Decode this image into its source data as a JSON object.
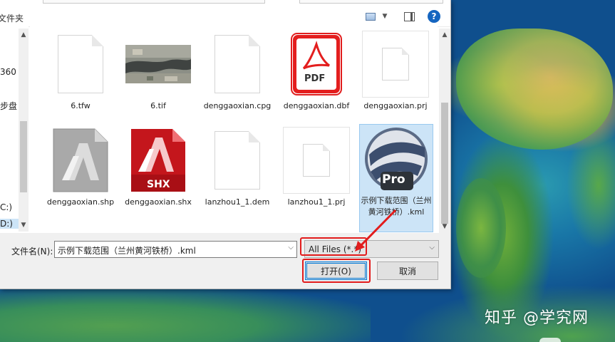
{
  "window": {
    "nav_label": "文件夹"
  },
  "left_nav": {
    "items": [
      {
        "label": "360"
      },
      {
        "label": "步盘"
      },
      {
        "label": "C:)"
      },
      {
        "label": "D:)"
      }
    ]
  },
  "files": [
    {
      "name": "6.tfw",
      "icon": "blank-document-icon"
    },
    {
      "name": "6.tif",
      "icon": "satellite-image-thumbnail"
    },
    {
      "name": "denggaoxian.cpg",
      "icon": "blank-document-icon"
    },
    {
      "name": "denggaoxian.dbf",
      "icon": "pdf-icon",
      "badge": "PDF"
    },
    {
      "name": "denggaoxian.prj",
      "icon": "small-document-icon"
    },
    {
      "name": "denggaoxian.shp",
      "icon": "autocad-gray-icon"
    },
    {
      "name": "denggaoxian.shx",
      "icon": "autocad-red-icon",
      "badge": "SHX"
    },
    {
      "name": "lanzhou1_1.dem",
      "icon": "blank-document-icon"
    },
    {
      "name": "lanzhou1_1.prj",
      "icon": "small-document-icon"
    },
    {
      "name": "示例下载范围（兰州黄河铁桥）.kml",
      "icon": "google-earth-pro-icon",
      "badge": "Pro",
      "selected": true
    }
  ],
  "bottom": {
    "filename_label": "文件名(N):",
    "filename_value": "示例下载范围（兰州黄河铁桥）.kml",
    "filter_value": "All Files (*.*)",
    "open_label": "打开(O)",
    "cancel_label": "取消"
  },
  "watermark": "知乎 @学究网",
  "colors": {
    "selection": "#cce4f7",
    "highlight": "#e21c1c",
    "accent": "#0078d7"
  }
}
